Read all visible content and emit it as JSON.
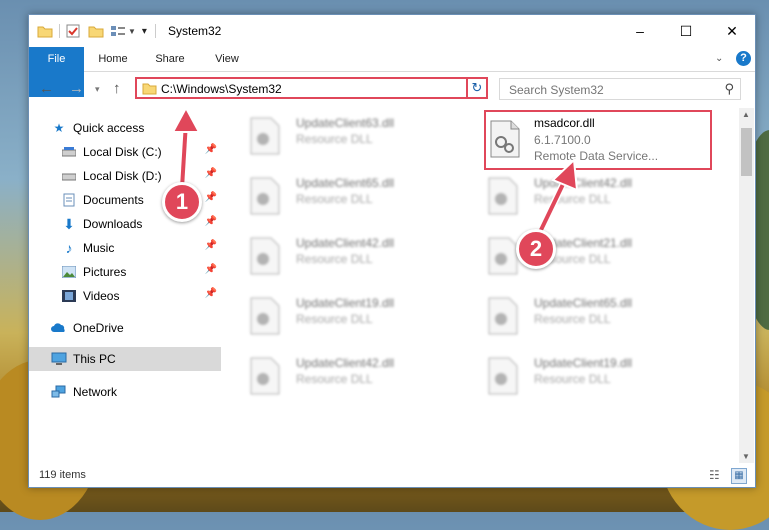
{
  "window": {
    "title": "System32",
    "controls": {
      "minimize": "–",
      "maximize": "☐",
      "close": "✕"
    }
  },
  "ribbon": {
    "tabs": [
      "File",
      "Home",
      "Share",
      "View"
    ],
    "help": "?"
  },
  "address": {
    "path": "C:\\Windows\\System32",
    "search_placeholder": "Search System32"
  },
  "nav": {
    "items": [
      {
        "label": "Quick access",
        "icon": "star-icon"
      },
      {
        "label": "Local Disk (C:)",
        "icon": "drive-icon"
      },
      {
        "label": "Local Disk (D:)",
        "icon": "drive-icon"
      },
      {
        "label": "Documents",
        "icon": "documents-icon"
      },
      {
        "label": "Downloads",
        "icon": "download-icon"
      },
      {
        "label": "Music",
        "icon": "music-icon"
      },
      {
        "label": "Pictures",
        "icon": "pictures-icon"
      },
      {
        "label": "Videos",
        "icon": "videos-icon"
      },
      {
        "label": "OneDrive",
        "icon": "cloud-icon"
      },
      {
        "label": "This PC",
        "icon": "computer-icon"
      },
      {
        "label": "Network",
        "icon": "network-icon"
      }
    ]
  },
  "files": [
    {
      "name": "UpdateClient63.dll",
      "desc": "Resource DLL"
    },
    {
      "name": "msadcor.dll",
      "version": "6.1.7100.0",
      "desc": "Remote Data Service..."
    },
    {
      "name": "UpdateClient65.dll",
      "desc": "Resource DLL"
    },
    {
      "name": "UpdateClient42.dll",
      "desc": "Resource DLL"
    },
    {
      "name": "UpdateClient42.dll",
      "desc": "Resource DLL"
    },
    {
      "name": "UpdateClient21.dll",
      "desc": "Resource DLL"
    },
    {
      "name": "UpdateClient19.dll",
      "desc": "Resource DLL"
    },
    {
      "name": "UpdateClient65.dll",
      "desc": "Resource DLL"
    },
    {
      "name": "UpdateClient42.dll",
      "desc": "Resource DLL"
    },
    {
      "name": "UpdateClient19.dll",
      "desc": "Resource DLL"
    }
  ],
  "status": {
    "count": "119 items"
  },
  "annotations": {
    "badge1": "1",
    "badge2": "2"
  },
  "colors": {
    "accent": "#1979ca",
    "highlight": "#e0475a",
    "selected": "#d9d9d9"
  }
}
